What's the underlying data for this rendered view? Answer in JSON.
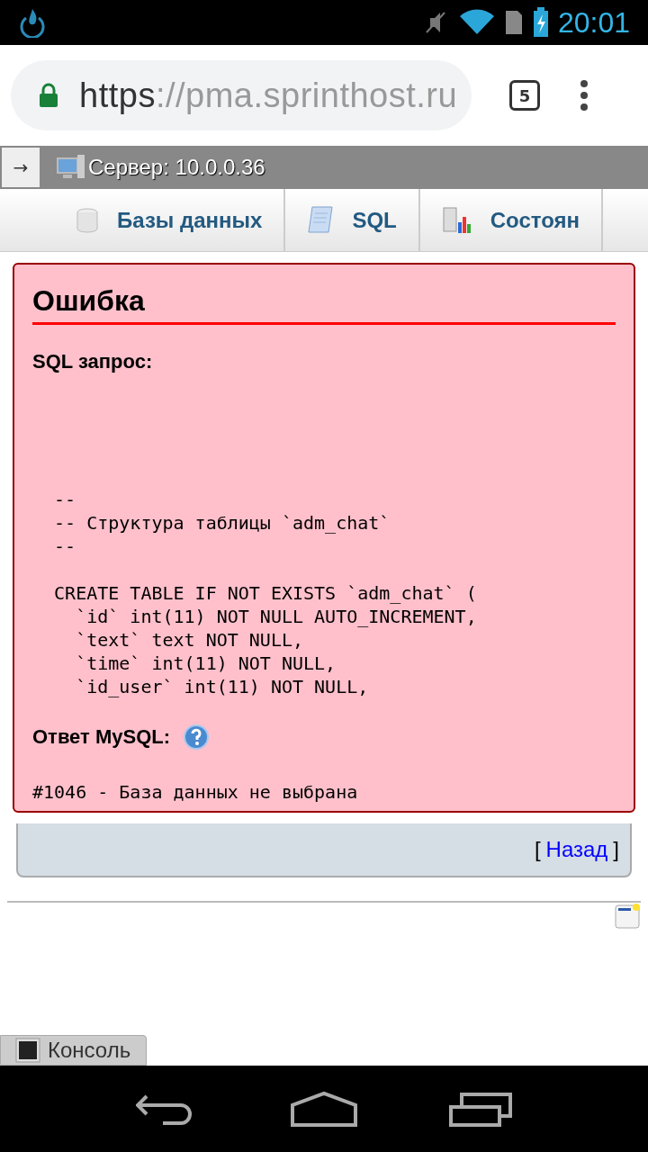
{
  "status_bar": {
    "time": "20:01"
  },
  "browser": {
    "url_scheme": "https",
    "url_rest": "://pma.sprinthost.ru",
    "tab_count": "5"
  },
  "server_bar": {
    "toggle": "→",
    "title": "Сервер: 10.0.0.36"
  },
  "tabs": [
    {
      "label": "Базы данных",
      "kind": "database"
    },
    {
      "label": "SQL",
      "kind": "sql"
    },
    {
      "label": "Состоян",
      "kind": "status"
    }
  ],
  "error": {
    "title": "Ошибка",
    "query_label": "SQL запрос:",
    "query_blocks": [
      [
        "  --",
        "  -- Структура таблицы `adm_chat`",
        "  --"
      ],
      [
        "  CREATE TABLE IF NOT EXISTS `adm_chat` (",
        "    `id` int(11) NOT NULL AUTO_INCREMENT,",
        "    `text` text NOT NULL,",
        "    `time` int(11) NOT NULL,",
        "    `id_user` int(11) NOT NULL,"
      ]
    ],
    "response_label": "Ответ MySQL:",
    "response": "#1046 - База данных не выбрана"
  },
  "back": {
    "open": "[",
    "link": "Назад",
    "close": "]"
  },
  "console": {
    "label": "Консоль"
  }
}
